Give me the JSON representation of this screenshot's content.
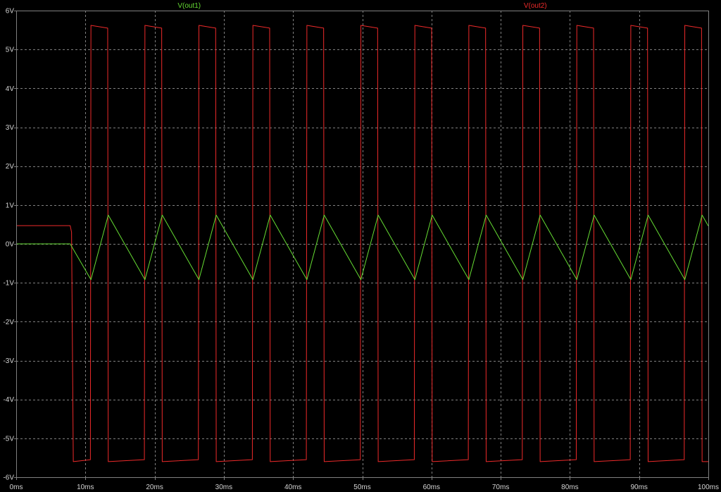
{
  "chart_data": {
    "type": "line",
    "xlim": [
      0,
      100
    ],
    "ylim": [
      -6,
      6
    ],
    "x_tick_values": [
      0,
      10,
      20,
      30,
      40,
      50,
      60,
      70,
      80,
      90,
      100
    ],
    "x_ticks": [
      "0ms",
      "10ms",
      "20ms",
      "30ms",
      "40ms",
      "50ms",
      "60ms",
      "70ms",
      "80ms",
      "90ms",
      "100ms"
    ],
    "y_tick_values": [
      6,
      5,
      4,
      3,
      2,
      1,
      0,
      -1,
      -2,
      -3,
      -4,
      -5,
      -6
    ],
    "y_ticks": [
      "6V",
      "5V",
      "4V",
      "3V",
      "2V",
      "1V",
      "0V",
      "-1V",
      "-2V",
      "-3V",
      "-4V",
      "-5V",
      "-6V"
    ],
    "grid": true,
    "legend_placement": "top",
    "colors": {
      "background": "#000000",
      "grid": "#808080",
      "frame": "#808080",
      "axis_text": "#d4d4d4"
    },
    "series": [
      {
        "name": "V(out1)",
        "color": "#66dd33",
        "x": [
          0,
          7.8,
          10.8,
          13.3,
          18.6,
          21.1,
          26.4,
          28.9,
          34.2,
          36.7,
          42,
          44.5,
          49.8,
          52.3,
          57.6,
          60.1,
          65.4,
          67.9,
          73.2,
          75.7,
          81,
          83.5,
          88.8,
          91.3,
          96.6,
          99.1,
          100
        ],
        "y": [
          0,
          0,
          -0.92,
          0.74,
          -0.92,
          0.74,
          -0.92,
          0.74,
          -0.92,
          0.74,
          -0.92,
          0.74,
          -0.92,
          0.74,
          -0.92,
          0.74,
          -0.92,
          0.74,
          -0.92,
          0.74,
          -0.92,
          0.74,
          -0.92,
          0.74,
          -0.92,
          0.74,
          0.46
        ]
      },
      {
        "name": "V(out2)",
        "color": "#ee2a2a",
        "x": [
          0,
          7.8,
          8.0,
          8.25,
          10.72,
          10.8,
          13.22,
          13.3,
          18.52,
          18.6,
          21.02,
          21.1,
          26.32,
          26.4,
          28.82,
          28.9,
          34.12,
          34.2,
          36.62,
          36.7,
          41.92,
          42,
          44.42,
          44.5,
          49.72,
          49.8,
          52.22,
          52.3,
          57.52,
          57.6,
          60.02,
          60.1,
          65.32,
          65.4,
          67.82,
          67.9,
          73.12,
          73.2,
          75.62,
          75.7,
          80.92,
          81,
          83.42,
          83.5,
          88.72,
          88.8,
          91.22,
          91.3,
          96.52,
          96.6,
          99.02,
          99.1,
          100
        ],
        "y": [
          0.47,
          0.47,
          0.3,
          -5.6,
          -5.55,
          5.62,
          5.55,
          -5.6,
          -5.55,
          5.62,
          5.55,
          -5.6,
          -5.55,
          5.62,
          5.55,
          -5.6,
          -5.55,
          5.62,
          5.55,
          -5.6,
          -5.55,
          5.62,
          5.55,
          -5.6,
          -5.55,
          5.62,
          5.55,
          -5.6,
          -5.55,
          5.62,
          5.55,
          -5.6,
          -5.55,
          5.62,
          5.55,
          -5.6,
          -5.55,
          5.62,
          5.55,
          -5.6,
          -5.55,
          5.62,
          5.55,
          -5.6,
          -5.55,
          5.62,
          5.55,
          -5.6,
          -5.55,
          5.62,
          5.55,
          -5.6,
          -5.6
        ]
      }
    ]
  }
}
